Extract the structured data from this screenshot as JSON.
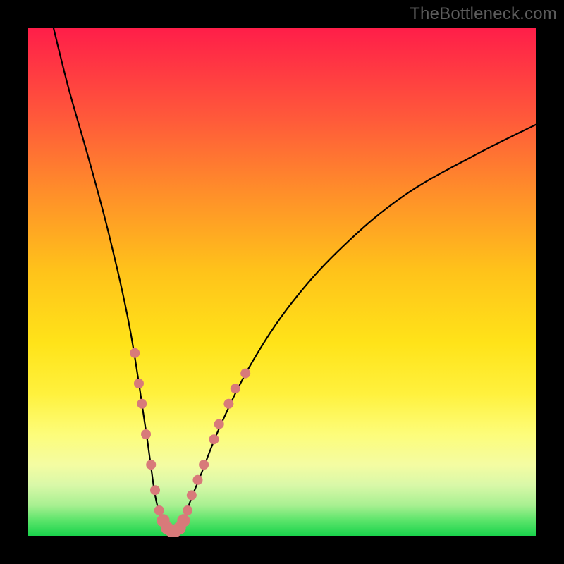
{
  "watermark": "TheBottleneck.com",
  "chart_data": {
    "type": "line",
    "title": "",
    "xlabel": "",
    "ylabel": "",
    "xlim": [
      0,
      100
    ],
    "ylim": [
      0,
      100
    ],
    "series": [
      {
        "name": "curve",
        "x": [
          5,
          8,
          12,
          16,
          20,
          23,
          24,
          25,
          26,
          27,
          28,
          29,
          30,
          31,
          32,
          34,
          38,
          44,
          52,
          62,
          74,
          88,
          100
        ],
        "y": [
          100,
          88,
          74,
          59,
          41,
          22,
          15,
          8,
          4,
          2,
          1,
          1,
          2,
          4,
          7,
          12,
          22,
          34,
          46,
          57,
          67,
          75,
          81
        ]
      }
    ],
    "markers": [
      {
        "x": 21.0,
        "y": 36,
        "r": 1.0
      },
      {
        "x": 21.8,
        "y": 30,
        "r": 1.0
      },
      {
        "x": 22.4,
        "y": 26,
        "r": 1.0
      },
      {
        "x": 23.2,
        "y": 20,
        "r": 1.0
      },
      {
        "x": 24.2,
        "y": 14,
        "r": 1.0
      },
      {
        "x": 25.0,
        "y": 9,
        "r": 1.0
      },
      {
        "x": 25.8,
        "y": 5,
        "r": 1.0
      },
      {
        "x": 26.6,
        "y": 3,
        "r": 1.3
      },
      {
        "x": 27.4,
        "y": 1.5,
        "r": 1.3
      },
      {
        "x": 28.2,
        "y": 1,
        "r": 1.3
      },
      {
        "x": 29.0,
        "y": 1,
        "r": 1.3
      },
      {
        "x": 29.8,
        "y": 1.5,
        "r": 1.3
      },
      {
        "x": 30.6,
        "y": 3,
        "r": 1.3
      },
      {
        "x": 31.4,
        "y": 5,
        "r": 1.0
      },
      {
        "x": 32.2,
        "y": 8,
        "r": 1.0
      },
      {
        "x": 33.4,
        "y": 11,
        "r": 1.0
      },
      {
        "x": 34.6,
        "y": 14,
        "r": 1.0
      },
      {
        "x": 36.6,
        "y": 19,
        "r": 1.0
      },
      {
        "x": 37.6,
        "y": 22,
        "r": 1.0
      },
      {
        "x": 39.5,
        "y": 26,
        "r": 1.0
      },
      {
        "x": 40.8,
        "y": 29,
        "r": 1.0
      },
      {
        "x": 42.8,
        "y": 32,
        "r": 1.0
      }
    ],
    "marker_color": "#d87a7a",
    "curve_color": "#000000"
  }
}
